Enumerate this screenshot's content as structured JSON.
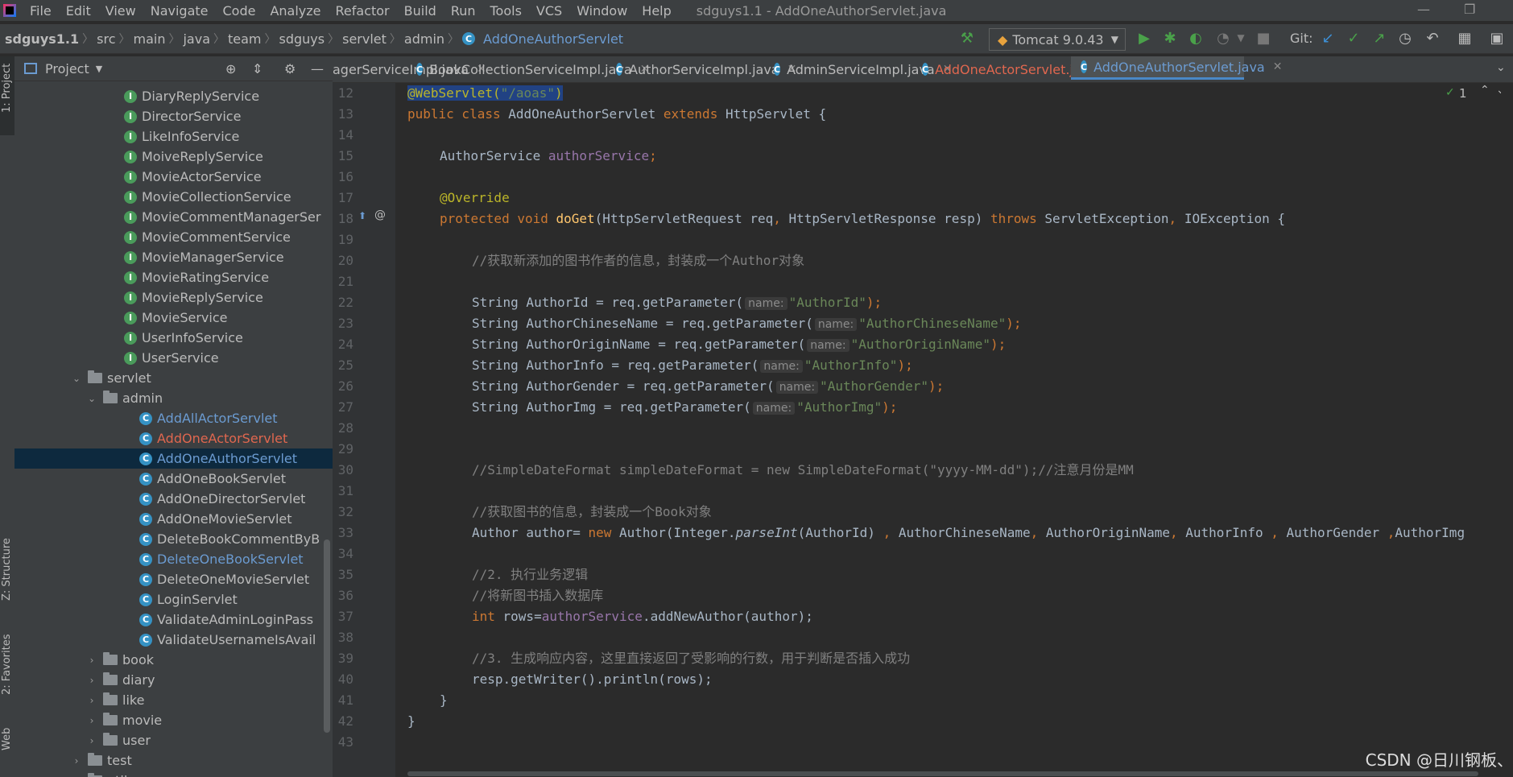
{
  "menu": {
    "items": [
      "File",
      "Edit",
      "View",
      "Navigate",
      "Code",
      "Analyze",
      "Refactor",
      "Build",
      "Run",
      "Tools",
      "VCS",
      "Window",
      "Help"
    ],
    "window_title": "sdguys1.1 - AddOneAuthorServlet.java"
  },
  "breadcrumb": [
    "sdguys1.1",
    "src",
    "main",
    "java",
    "team",
    "sdguys",
    "servlet",
    "admin",
    "AddOneAuthorServlet"
  ],
  "toolbar": {
    "run_config": "Tomcat 9.0.43",
    "git_label": "Git:"
  },
  "left_stripe": {
    "project": "1: Project",
    "structure": "Z: Structure",
    "favorites": "2: Favorites",
    "web": "Web"
  },
  "project_panel": {
    "title": "Project"
  },
  "tree": [
    {
      "label": "DiaryReplyService",
      "type": "interface",
      "level": 4
    },
    {
      "label": "DirectorService",
      "type": "interface",
      "level": 4
    },
    {
      "label": "LikeInfoService",
      "type": "interface",
      "level": 4
    },
    {
      "label": "MoiveReplyService",
      "type": "interface",
      "level": 4
    },
    {
      "label": "MovieActorService",
      "type": "interface",
      "level": 4
    },
    {
      "label": "MovieCollectionService",
      "type": "interface",
      "level": 4
    },
    {
      "label": "MovieCommentManagerSer",
      "type": "interface",
      "level": 4
    },
    {
      "label": "MovieCommentService",
      "type": "interface",
      "level": 4
    },
    {
      "label": "MovieManagerService",
      "type": "interface",
      "level": 4
    },
    {
      "label": "MovieRatingService",
      "type": "interface",
      "level": 4
    },
    {
      "label": "MovieReplyService",
      "type": "interface",
      "level": 4
    },
    {
      "label": "MovieService",
      "type": "interface",
      "level": 4
    },
    {
      "label": "UserInfoService",
      "type": "interface",
      "level": 4
    },
    {
      "label": "UserService",
      "type": "interface",
      "level": 4
    },
    {
      "label": "servlet",
      "type": "folder-open",
      "level": 3
    },
    {
      "label": "admin",
      "type": "folder-open",
      "level": 4
    },
    {
      "label": "AddAllActorServlet",
      "type": "class",
      "level": 5,
      "color": "#6b9bd1"
    },
    {
      "label": "AddOneActorServlet",
      "type": "class",
      "level": 5,
      "color": "#e0674f"
    },
    {
      "label": "AddOneAuthorServlet",
      "type": "class",
      "level": 5,
      "color": "#6b9bd1",
      "selected": true
    },
    {
      "label": "AddOneBookServlet",
      "type": "class",
      "level": 5
    },
    {
      "label": "AddOneDirectorServlet",
      "type": "class",
      "level": 5
    },
    {
      "label": "AddOneMovieServlet",
      "type": "class",
      "level": 5
    },
    {
      "label": "DeleteBookCommentByB",
      "type": "class",
      "level": 5
    },
    {
      "label": "DeleteOneBookServlet",
      "type": "class",
      "level": 5,
      "color": "#6b9bd1"
    },
    {
      "label": "DeleteOneMovieServlet",
      "type": "class",
      "level": 5
    },
    {
      "label": "LoginServlet",
      "type": "class",
      "level": 5
    },
    {
      "label": "ValidateAdminLoginPass",
      "type": "class",
      "level": 5
    },
    {
      "label": "ValidateUsernameIsAvail",
      "type": "class",
      "level": 5
    },
    {
      "label": "book",
      "type": "folder-closed",
      "level": 4
    },
    {
      "label": "diary",
      "type": "folder-closed",
      "level": 4
    },
    {
      "label": "like",
      "type": "folder-closed",
      "level": 4
    },
    {
      "label": "movie",
      "type": "folder-closed",
      "level": 4
    },
    {
      "label": "user",
      "type": "folder-closed",
      "level": 4
    },
    {
      "label": "test",
      "type": "folder-closed",
      "level": 3
    },
    {
      "label": "util",
      "type": "folder-closed",
      "level": 3
    }
  ],
  "tabs": [
    {
      "label": "agerServiceImpl.java",
      "icon": false
    },
    {
      "label": "BookCollectionServiceImpl.java",
      "icon": true
    },
    {
      "label": "AuthorServiceImpl.java",
      "icon": true
    },
    {
      "label": "AdminServiceImpl.java",
      "icon": true
    },
    {
      "label": "AddOneActorServlet.java",
      "icon": true,
      "color": "#e0674f"
    },
    {
      "label": "AddOneAuthorServlet.java",
      "icon": true,
      "active": true,
      "color": "#6b9bd1"
    }
  ],
  "editor": {
    "inspection_count": "1",
    "line_numbers": [
      "12",
      "13",
      "14",
      "15",
      "16",
      "17",
      "18",
      "19",
      "20",
      "21",
      "22",
      "23",
      "24",
      "25",
      "26",
      "27",
      "28",
      "29",
      "30",
      "31",
      "32",
      "33",
      "34",
      "35",
      "36",
      "37",
      "38",
      "39",
      "40",
      "41",
      "42",
      "43"
    ],
    "code": {
      "l12_ann": "@WebServlet(",
      "l12_str": "\"/aoas\"",
      "l12_close": ")",
      "l13_kw": "public class ",
      "l13_name": "AddOneAuthorServlet ",
      "l13_kw2": "extends ",
      "l13_rest": "HttpServlet {",
      "l15_type": "AuthorService ",
      "l15_field": "authorService",
      "l15_semi": ";",
      "l17": "@Override",
      "l18_kw": "protected void ",
      "l18_fn": "doGet",
      "l18_a": "(HttpServletRequest req",
      "l18_b": "HttpServletResponse resp) ",
      "l18_kw2": "throws ",
      "l18_c": "ServletException",
      "l18_d": "IOException {",
      "l20": "//获取新添加的图书作者的信息，封装成一个Author对象",
      "hint_name": "name:",
      "params": [
        {
          "decl": "String AuthorId = req.getParameter(",
          "arg": "\"AuthorId\""
        },
        {
          "decl": "String AuthorChineseName = req.getParameter(",
          "arg": "\"AuthorChineseName\""
        },
        {
          "decl": "String AuthorOriginName = req.getParameter(",
          "arg": "\"AuthorOriginName\""
        },
        {
          "decl": "String AuthorInfo = req.getParameter(",
          "arg": "\"AuthorInfo\""
        },
        {
          "decl": "String AuthorGender = req.getParameter(",
          "arg": "\"AuthorGender\""
        },
        {
          "decl": "String AuthorImg = req.getParameter(",
          "arg": "\"AuthorImg\""
        }
      ],
      "param_close": ");",
      "l30": "//SimpleDateFormat simpleDateFormat = new SimpleDateFormat(\"yyyy-MM-dd\");//注意月份是MM",
      "l32": "//获取图书的信息，封装成一个Book对象",
      "l33_a": "Author author= ",
      "l33_new": "new ",
      "l33_b": "Author(Integer.",
      "l33_parse": "parseInt",
      "l33_c": "(AuthorId) ",
      "l33_d": " AuthorChineseName",
      "l33_e": " AuthorOriginName",
      "l33_f": " AuthorInfo ",
      "l33_g": " AuthorGender ",
      "l33_h": "AuthorImg",
      "comma": ",",
      "l35": "//2. 执行业务逻辑",
      "l36": "//将新图书插入数据库",
      "l37_kw": "int ",
      "l37_a": "rows=",
      "l37_field": "authorService",
      "l37_b": ".addNewAuthor(author);",
      "l39": "//3. 生成响应内容，这里直接返回了受影响的行数，用于判断是否插入成功",
      "l40": "resp.getWriter().println(rows);",
      "l41": "}",
      "l42": "}"
    }
  },
  "watermark": "CSDN @日川钢板、"
}
